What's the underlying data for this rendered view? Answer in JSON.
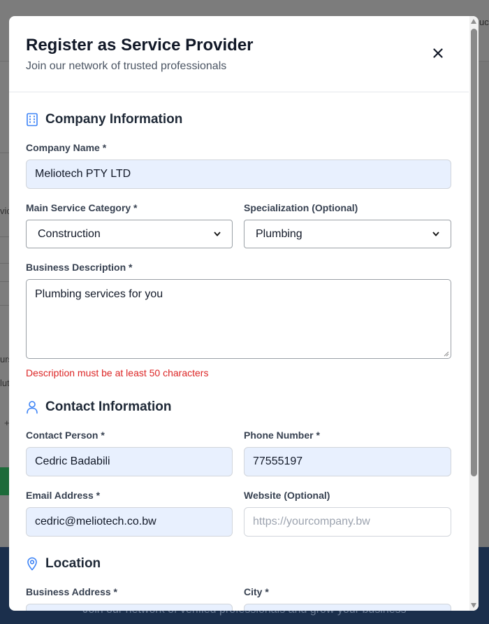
{
  "background": {
    "top_right_fragment": "uct",
    "left_fragments": [
      "vic",
      "urs",
      "luti",
      "+"
    ],
    "footer_text": "Join our network of verified professionals and grow your business"
  },
  "modal": {
    "title": "Register as Service Provider",
    "subtitle": "Join our network of trusted professionals",
    "close_label": "×"
  },
  "company": {
    "section_title": "Company Information",
    "name_label": "Company Name *",
    "name_value": "Meliotech PTY LTD",
    "category_label": "Main Service Category *",
    "category_value": "Construction",
    "specialization_label": "Specialization (Optional)",
    "specialization_value": "Plumbing",
    "description_label": "Business Description *",
    "description_value": "Plumbing services for you",
    "description_error": "Description must be at least 50 characters"
  },
  "contact": {
    "section_title": "Contact Information",
    "person_label": "Contact Person *",
    "person_value": "Cedric Badabili",
    "phone_label": "Phone Number *",
    "phone_value": "77555197",
    "email_label": "Email Address *",
    "email_value": "cedric@meliotech.co.bw",
    "website_label": "Website (Optional)",
    "website_placeholder": "https://yourcompany.bw"
  },
  "location": {
    "section_title": "Location",
    "address_label": "Business Address *",
    "city_label": "City *"
  },
  "colors": {
    "accent": "#3b82f6",
    "error": "#dc2626",
    "filled_field": "#e8f0fe"
  }
}
